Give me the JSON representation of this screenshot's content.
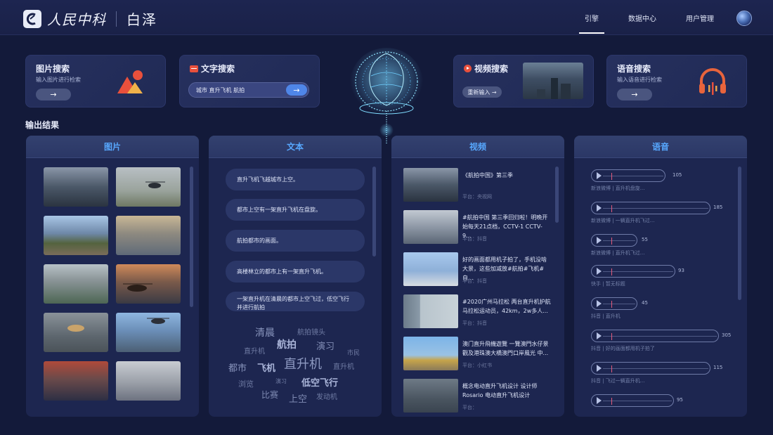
{
  "header": {
    "logo_text": "人民中科",
    "brand": "白泽",
    "nav": [
      "引擎",
      "数据中心",
      "用户管理"
    ],
    "active_nav": 0
  },
  "search": {
    "image": {
      "title": "图片搜索",
      "subtitle": "输入图片进行检索"
    },
    "text": {
      "title": "文字搜索",
      "input_value": "城市 直升飞机 航拍"
    },
    "video": {
      "title": "视频搜索",
      "refill_label": "重新输入 →"
    },
    "audio": {
      "title": "语音搜索",
      "subtitle": "输入语音进行检索"
    }
  },
  "results_title": "输出结果",
  "panels": {
    "image": {
      "title": "图片"
    },
    "text": {
      "title": "文本",
      "items": [
        "直升飞机飞越城市上空。",
        "都市上空有一架直升飞机在盘旋。",
        "航拍都市的画面。",
        "高楼林立的都市上有一架直升飞机。",
        "一架直升机在清晨的都市上空飞过，低空飞行并进行航拍"
      ],
      "cloud": [
        "清晨",
        "航拍镜头",
        "直升机",
        "航拍",
        "演习",
        "市民",
        "都市",
        "飞机",
        "直升机",
        "直升机",
        "浏览",
        "演习",
        "低空飞行",
        "比赛",
        "上空",
        "发动机"
      ]
    },
    "video": {
      "title": "视频",
      "items": [
        {
          "title": "《航拍中国》第三季",
          "meta": "平台：央视网"
        },
        {
          "title": "#航拍中国 第三季回归啦！明晚开始每天21点档，CCTV-1 CCTV-9...",
          "meta": "平台：抖音"
        },
        {
          "title": "好的画面都用机子拍了，手机没啥大景，这些加减放#航拍#飞机#自...",
          "meta": "平台：抖音"
        },
        {
          "title": "#2020广州马拉松 两台直升机护航马拉松运动员，42km，2w多人...",
          "meta": "平台：抖音"
        },
        {
          "title": "澳门直升飛機遊覽 一覽澳門水仔景觀及港珠澳大橋澳門口岸風光 中...",
          "meta": "平台：小红书"
        },
        {
          "title": "概念电动直升飞机设计 设计师 Rosario 电动直升飞机设计",
          "meta": "平台："
        }
      ]
    },
    "audio": {
      "title": "语音",
      "items": [
        {
          "duration": "105",
          "meta": "新浪微博  |  直升机盘旋..."
        },
        {
          "duration": "185",
          "meta": "新浪微博  |  一辆直升机飞过..."
        },
        {
          "duration": "55",
          "meta": "新浪微博  |  直升机飞过..."
        },
        {
          "duration": "93",
          "meta": "快手  |  暂无标题"
        },
        {
          "duration": "45",
          "meta": "抖音  |  直升机"
        },
        {
          "duration": "305",
          "meta": "抖音  |  好的画面都用机子拍了"
        },
        {
          "duration": "115",
          "meta": "抖音  |  飞过一辆直升机..."
        },
        {
          "duration": "95",
          "meta": ""
        }
      ]
    }
  },
  "colors": {
    "background": "#131a3a",
    "panel": "#1d2650",
    "panel_title": "#57a8ff",
    "accent_button": "#4f86e8",
    "audio_icon": "#e8643c"
  }
}
